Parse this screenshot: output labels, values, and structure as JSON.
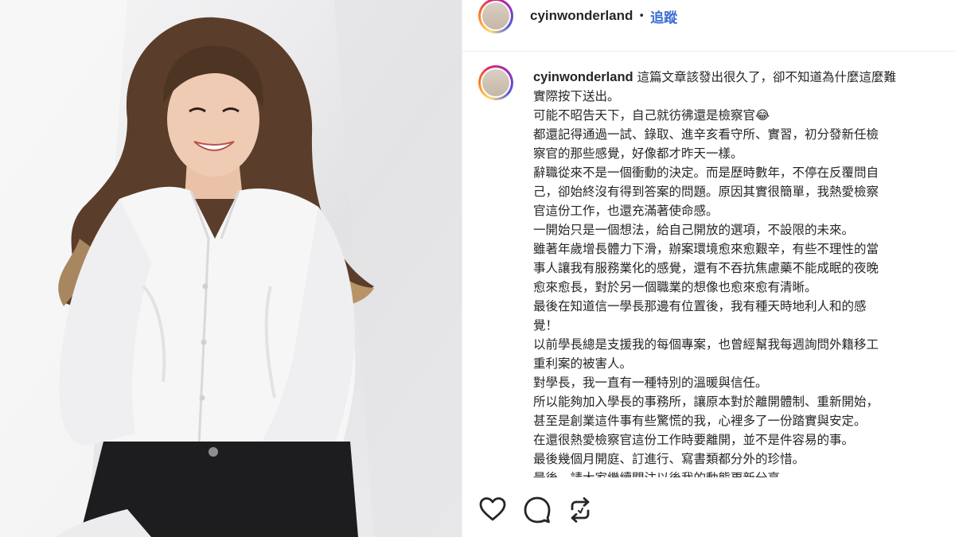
{
  "post": {
    "username": "cyinwonderland",
    "separator": "•",
    "follow_label": "追蹤",
    "caption_lines": [
      "這篇文章該發出很久了，卻不知道為什麼這麼難",
      "實際按下送出。",
      "可能不昭告天下，自己就彷彿還是檢察官😂",
      "都還記得通過一試、錄取、進辛亥看守所、實習，初分發新任檢",
      "察官的那些感覺，好像都才昨天一樣。",
      "辭職從來不是一個衝動的決定。而是歷時數年，不停在反覆問自",
      "己，卻始終沒有得到答案的問題。原因其實很簡單，我熱愛檢察",
      "官這份工作，也還充滿著使命感。",
      "一開始只是一個想法，給自己開放的選項，不設限的未來。",
      "雖著年歲增長體力下滑，辦案環境愈來愈艱辛，有些不理性的當",
      "事人讓我有服務業化的感覺，還有不吞抗焦慮藥不能成眠的夜晚",
      "愈來愈長，對於另一個職業的想像也愈來愈有清晰。",
      "最後在知道信一學長那邊有位置後，我有種天時地利人和的感",
      "覺！",
      "以前學長總是支援我的每個專案，也曾經幫我每週詢問外籍移工",
      "重利案的被害人。",
      "對學長，我一直有一種特別的溫暖與信任。",
      "所以能夠加入學長的事務所，讓原本對於離開體制、重新開始，",
      "甚至是創業這件事有些驚慌的我，心裡多了一份踏實與安定。",
      "在還很熱愛檢察官這份工作時要離開，並不是件容易的事。",
      "最後幾個月開庭、訂進行、寫書類都分外的珍惜。",
      "最後，請大家繼續關注以後我的動態更新分享…"
    ]
  },
  "actions": [
    {
      "name": "like-heart-icon",
      "icon": "heart"
    },
    {
      "name": "comment-bubble-icon",
      "icon": "comment"
    },
    {
      "name": "repost-icon",
      "icon": "repost"
    }
  ],
  "colors": {
    "follow": "#3b6fd6",
    "text": "#262626",
    "story_ring": [
      "#feda75",
      "#fa7e1e",
      "#d62976",
      "#962fbf",
      "#4f5bd5"
    ]
  }
}
